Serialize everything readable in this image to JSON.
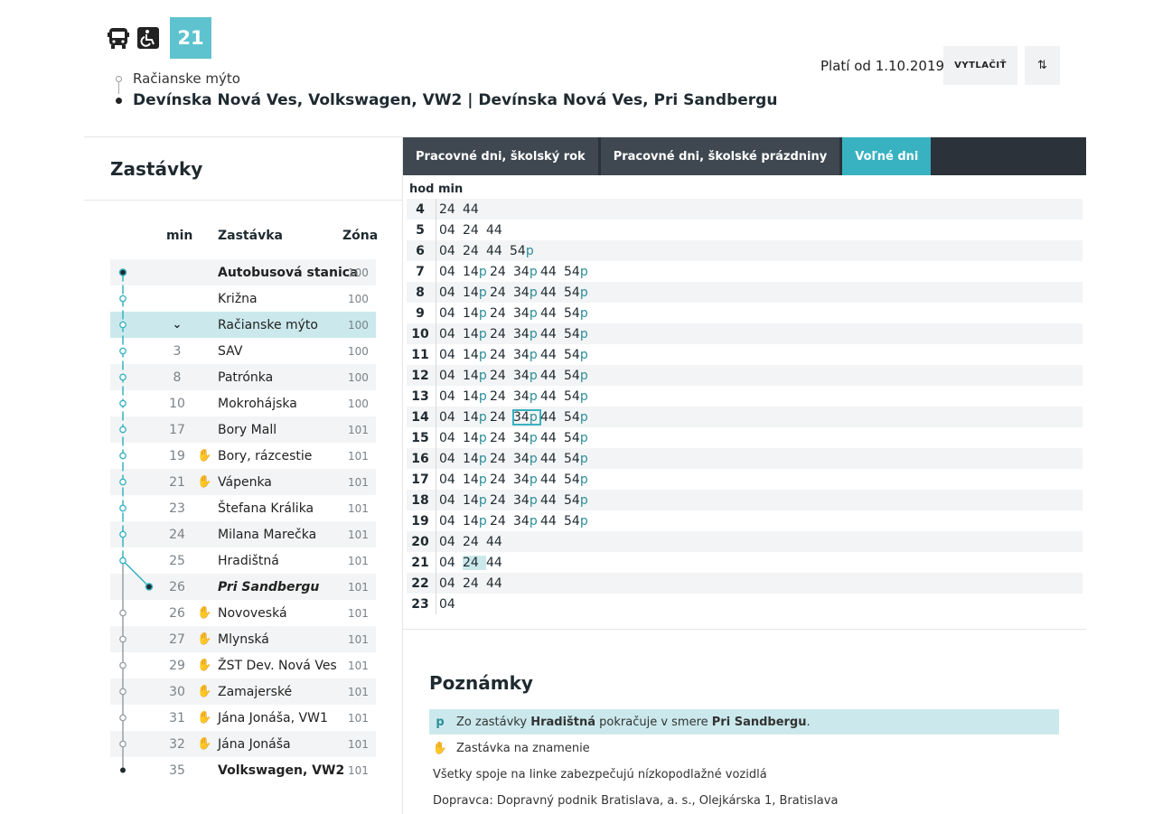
{
  "header": {
    "icons": [
      "bus-icon",
      "wheelchair-icon"
    ],
    "line_number": "21",
    "route_from": "Račianske mýto",
    "route_to": "Devínska Nová Ves, Volkswagen, VW2 | Devínska Nová Ves, Pri Sandbergu",
    "valid_from": "Platí od 1.10.2019",
    "print_label": "VYTLAČIŤ",
    "swap_label": "⇅"
  },
  "stops": {
    "title": "Zastávky",
    "col_min": "min",
    "col_stop": "Zastávka",
    "col_zone": "Zóna",
    "items": [
      {
        "min": "",
        "name": "Autobusová stanica",
        "zone": "100",
        "style": "bold",
        "on_request": false
      },
      {
        "min": "",
        "name": "Križna",
        "zone": "100",
        "style": "",
        "on_request": false
      },
      {
        "min": "⌄",
        "name": "Račianske mýto",
        "zone": "100",
        "style": "",
        "on_request": false,
        "selected": true
      },
      {
        "min": "3",
        "name": "SAV",
        "zone": "100",
        "style": "",
        "on_request": false
      },
      {
        "min": "8",
        "name": "Patrónka",
        "zone": "100",
        "style": "",
        "on_request": false
      },
      {
        "min": "10",
        "name": "Mokrohájska",
        "zone": "100",
        "style": "",
        "on_request": false
      },
      {
        "min": "17",
        "name": "Bory Mall",
        "zone": "101",
        "style": "",
        "on_request": false
      },
      {
        "min": "19",
        "name": "Bory, rázcestie",
        "zone": "101",
        "style": "",
        "on_request": true
      },
      {
        "min": "21",
        "name": "Vápenka",
        "zone": "101",
        "style": "",
        "on_request": true
      },
      {
        "min": "23",
        "name": "Štefana Králika",
        "zone": "101",
        "style": "",
        "on_request": false
      },
      {
        "min": "24",
        "name": "Milana Marečka",
        "zone": "101",
        "style": "",
        "on_request": false
      },
      {
        "min": "25",
        "name": "Hradištná",
        "zone": "101",
        "style": "",
        "on_request": false
      },
      {
        "min": "26",
        "name": "Pri Sandbergu",
        "zone": "101",
        "style": "bi",
        "on_request": false
      },
      {
        "min": "26",
        "name": "Novoveská",
        "zone": "101",
        "style": "",
        "on_request": true
      },
      {
        "min": "27",
        "name": "Mlynská",
        "zone": "101",
        "style": "",
        "on_request": true
      },
      {
        "min": "29",
        "name": "ŽST Dev. Nová Ves",
        "zone": "101",
        "style": "",
        "on_request": true
      },
      {
        "min": "30",
        "name": "Zamajerské",
        "zone": "101",
        "style": "",
        "on_request": true
      },
      {
        "min": "31",
        "name": "Jána Jonáša, VW1",
        "zone": "101",
        "style": "",
        "on_request": true
      },
      {
        "min": "32",
        "name": "Jána Jonáša",
        "zone": "101",
        "style": "",
        "on_request": true
      },
      {
        "min": "35",
        "name": "Volkswagen, VW2",
        "zone": "101",
        "style": "bold",
        "on_request": false
      }
    ]
  },
  "timetable": {
    "tabs": [
      {
        "label": "Pracovné dni, školský rok",
        "active": false
      },
      {
        "label": "Pracovné dni, školské prázdniny",
        "active": false
      },
      {
        "label": "Voľné dni",
        "active": true
      }
    ],
    "col_hour": "hod",
    "col_min": "min",
    "rows": [
      {
        "hour": "4",
        "mins": [
          "24",
          "44"
        ]
      },
      {
        "hour": "5",
        "mins": [
          "04",
          "24",
          "44"
        ]
      },
      {
        "hour": "6",
        "mins": [
          "04",
          "24",
          "44",
          "54p"
        ]
      },
      {
        "hour": "7",
        "mins": [
          "04",
          "14p",
          "24",
          "34p",
          "44",
          "54p"
        ]
      },
      {
        "hour": "8",
        "mins": [
          "04",
          "14p",
          "24",
          "34p",
          "44",
          "54p"
        ]
      },
      {
        "hour": "9",
        "mins": [
          "04",
          "14p",
          "24",
          "34p",
          "44",
          "54p"
        ]
      },
      {
        "hour": "10",
        "mins": [
          "04",
          "14p",
          "24",
          "34p",
          "44",
          "54p"
        ]
      },
      {
        "hour": "11",
        "mins": [
          "04",
          "14p",
          "24",
          "34p",
          "44",
          "54p"
        ]
      },
      {
        "hour": "12",
        "mins": [
          "04",
          "14p",
          "24",
          "34p",
          "44",
          "54p"
        ]
      },
      {
        "hour": "13",
        "mins": [
          "04",
          "14p",
          "24",
          "34p",
          "44",
          "54p"
        ]
      },
      {
        "hour": "14",
        "mins": [
          "04",
          "14p",
          "24",
          "34p",
          "44",
          "54p"
        ],
        "boxed": 3
      },
      {
        "hour": "15",
        "mins": [
          "04",
          "14p",
          "24",
          "34p",
          "44",
          "54p"
        ]
      },
      {
        "hour": "16",
        "mins": [
          "04",
          "14p",
          "24",
          "34p",
          "44",
          "54p"
        ]
      },
      {
        "hour": "17",
        "mins": [
          "04",
          "14p",
          "24",
          "34p",
          "44",
          "54p"
        ]
      },
      {
        "hour": "18",
        "mins": [
          "04",
          "14p",
          "24",
          "34p",
          "44",
          "54p"
        ]
      },
      {
        "hour": "19",
        "mins": [
          "04",
          "14p",
          "24",
          "34p",
          "44",
          "54p"
        ]
      },
      {
        "hour": "20",
        "mins": [
          "04",
          "24",
          "44"
        ]
      },
      {
        "hour": "21",
        "mins": [
          "04",
          "24",
          "44"
        ],
        "highlighted": 1
      },
      {
        "hour": "22",
        "mins": [
          "04",
          "24",
          "44"
        ]
      },
      {
        "hour": "23",
        "mins": [
          "04"
        ]
      }
    ]
  },
  "notes": {
    "title": "Poznámky",
    "p_mark": "p",
    "p_note_prefix": "Zo zastávky ",
    "p_note_from": "Hradištná",
    "p_note_mid": " pokračuje v smere ",
    "p_note_to": "Pri Sandbergu",
    "p_note_suffix": ".",
    "request_stop": "Zastávka na znamenie",
    "low_floor": "Všetky spoje na linke zabezpečujú nízkopodlažné vozidlá",
    "operator": "Dopravca: Dopravný podnik Bratislava, a. s., Olejkárska 1, Bratislava"
  },
  "colors": {
    "accent": "#38b2c1",
    "badge": "#5fc3cf",
    "highlight": "#cbe9ec",
    "tabbar": "#2b323a"
  }
}
